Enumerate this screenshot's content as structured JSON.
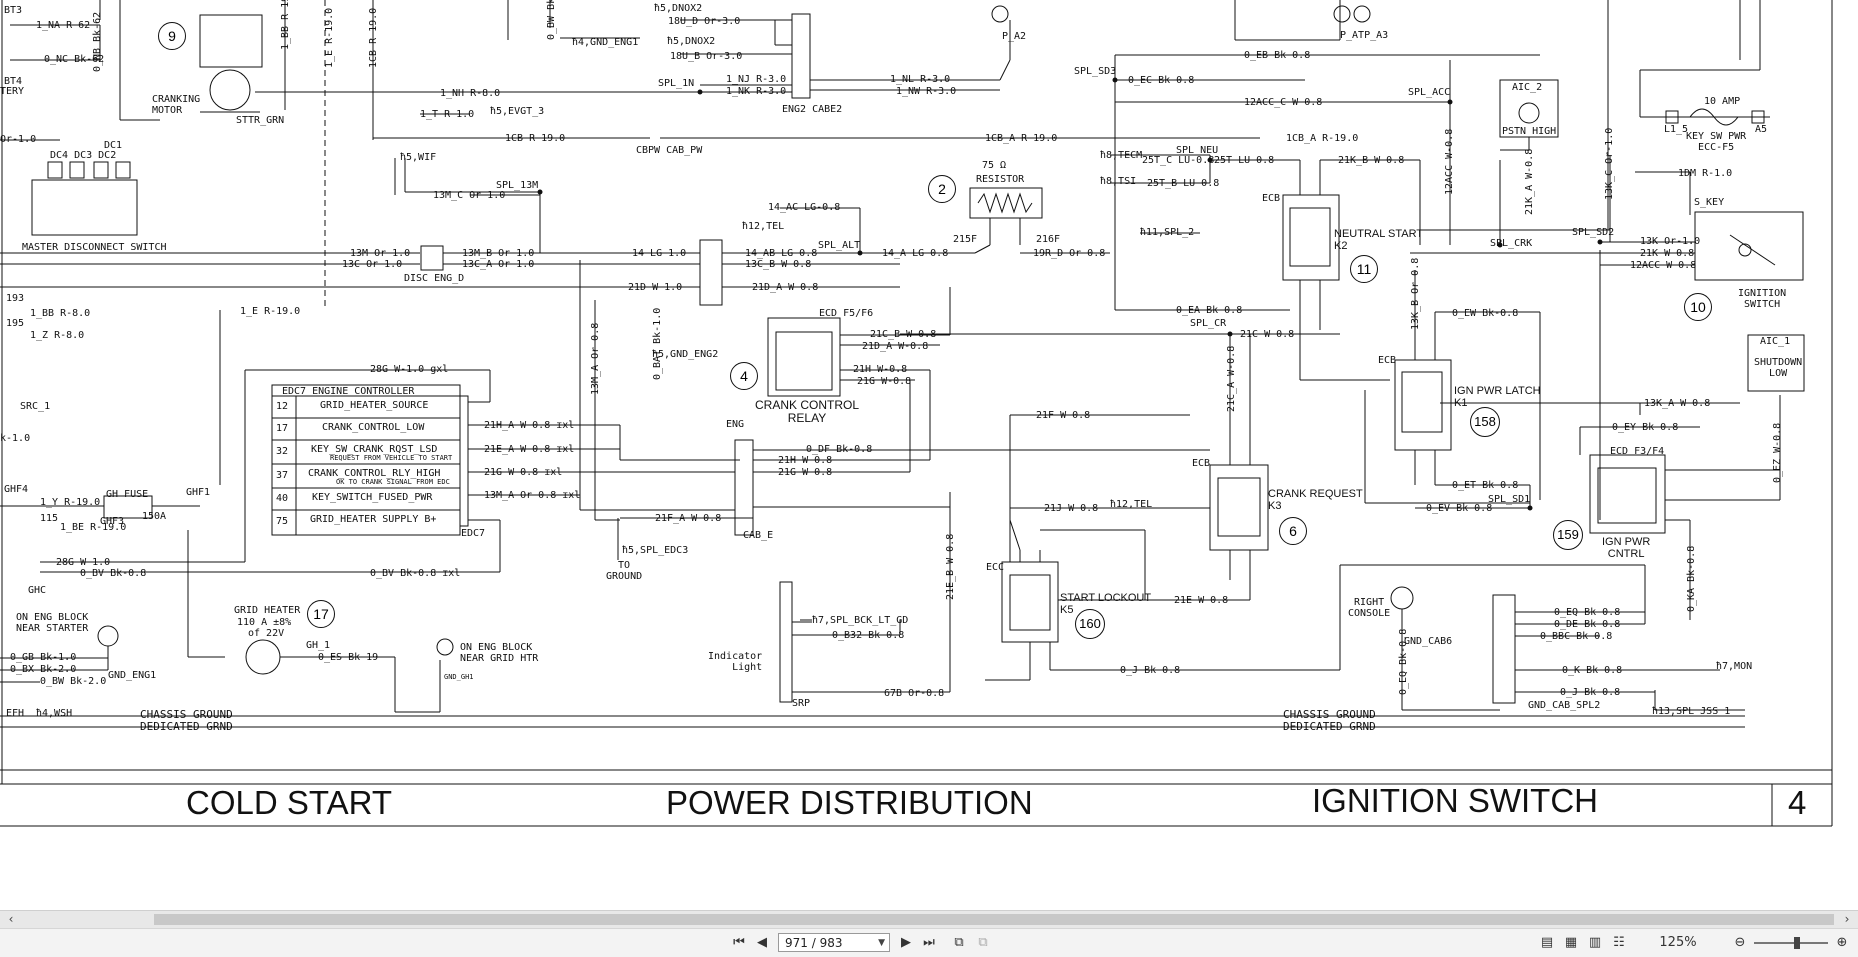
{
  "sections": {
    "cold_start": "COLD START",
    "power_distribution": "POWER DISTRIBUTION",
    "ignition_switch": "IGNITION SWITCH",
    "page_num": "4"
  },
  "ground_labels": {
    "chassis": "CHASSIS GROUND",
    "dedicated": "DEDICATED GRND"
  },
  "components": {
    "bt3": "BT3",
    "bt4": "BT4",
    "battery": "TERY",
    "cranking_motor": "CRANKING\nMOTOR",
    "sttr_grn": "STTR_GRN",
    "master_disconnect": "MASTER DISCONNECT SWITCH",
    "disc_eng": "DISC ENG_D",
    "src1": "SRC_1",
    "gh_fuse": "GH FUSE",
    "gh_fuse_amp": "150A",
    "ghf1": "GHF1",
    "ghf3": "GHF3",
    "ghf4": "GHF4",
    "ghc": "GHC",
    "grid_heater": "GRID HEATER",
    "grid_heater_spec1": "110 A ±8%",
    "grid_heater_spec2": "of 22V",
    "on_eng_block_starter": "ON ENG BLOCK\nNEAR STARTER",
    "gnd_eng1": "GND_ENG1",
    "on_eng_block_grid": "ON ENG BLOCK\nNEAR GRID HTR",
    "gnd_gh1": "GND_GH1",
    "edc7_title": "EDC7 ENGINE CONTROLLER",
    "edc7": "EDC7",
    "edc7_rows": [
      {
        "pin": "12",
        "name": "GRID_HEATER_SOURCE"
      },
      {
        "pin": "17",
        "name": "CRANK_CONTROL_LOW"
      },
      {
        "pin": "32",
        "name": "KEY_SW_CRANK_RQST_LSD",
        "note": "REQUEST FROM VEHICLE TO START"
      },
      {
        "pin": "37",
        "name": "CRANK_CONTROL_RLY_HIGH",
        "note": "OK TO CRANK SIGNAL FROM EDC"
      },
      {
        "pin": "40",
        "name": "KEY_SWITCH_FUSED_PWR"
      },
      {
        "pin": "75",
        "name": "GRID_HEATER SUPPLY B+"
      }
    ],
    "eng2_cabe2": "ENG2 CABE2",
    "cbpw_cab_pw": "CBPW CAB_PW",
    "resistor": "RESISTOR",
    "resistor_val": "75 Ω",
    "crank_control_relay": "CRANK CONTROL\nRELAY",
    "ecd_f5f6": "ECD  F5/F6",
    "to_ground": "TO\nGROUND",
    "indicator_light": "Indicator\nLight",
    "srp": "SRP",
    "neutral_start": "NEUTRAL START\nK2",
    "ign_pwr_latch": "IGN PWR LATCH\nK1",
    "crank_request": "CRANK REQUEST\nK3",
    "start_lockout": "START LOCKOUT\nK5",
    "ign_pwr_cntrl": "IGN PWR\nCNTRL",
    "ecd_f3f4": "ECD  F3/F4",
    "ignition_switch_comp": "IGNITION\nSWITCH",
    "s_key": "S_KEY",
    "key_sw_pwr": "KEY SW PWR\nECC-F5",
    "ten_amp": "10 AMP",
    "aic2": "AIC_2",
    "pstn_high": "PSTN HIGH",
    "aic1": "AIC_1",
    "shutdown_low": "SHUTDOWN\nLOW",
    "right_console": "RIGHT\nCONSOLE",
    "gnd_cab6": "GND_CAB6",
    "gnd_cab_spl2": "GND_CAB_SPL2",
    "ecb": "ECB",
    "ecc": "ECC",
    "eng": "ENG",
    "cab_e": "CAB_E"
  },
  "badges": [
    "9",
    "17",
    "4",
    "2",
    "11",
    "10",
    "158",
    "6",
    "160",
    "159"
  ],
  "wires": {
    "w1": "1_NA R-62",
    "w2": "0_NC Bk-62",
    "w3": "1_BB R-19.0",
    "w4": "1_E R-19.0",
    "w5": "1CB R-19.0",
    "w6": "0_BW Bk-0.8",
    "w7": "1_NH R-8.0",
    "w8": "1_T R-1.0",
    "w9": "ħ5,EVGT_3",
    "w10": "1CB R-19.0",
    "w11": "ħ5,WIF",
    "w12": "13M_C Or-1.0",
    "w13": "SPL_13M",
    "w14": "13M Or-1.0",
    "w15": "13C Or-1.0",
    "w16": "13M_B Or-1.0",
    "w17": "13C_A Or-1.0",
    "w18": "21D W-1.0",
    "w19": "ħ5,DNOX2",
    "w20": "18U_D Or-3.0",
    "w21": "ħ5,DNOX2",
    "w22": "18U_B Or-3.0",
    "w23": "ħ4,GND_ENG1",
    "w24": "SPL_1N",
    "w25": "1_NJ R-3.0",
    "w26": "1_NK R-3.0",
    "w27": "1_NL R-3.0",
    "w28": "1_NW R-3.0",
    "w29": "P_A2",
    "w30": "1CB_A R-19.0",
    "w31": "14_AC LG-0.8",
    "w32": "ħ12,TEL",
    "w33": "14 LG-1.0",
    "w34": "14_AB LG-0.8",
    "w35": "13C_B W-0.8",
    "w36": "SPL_ALT",
    "w37": "14_A LG-0.8",
    "w38": "21D_A W-0.8",
    "w39": "215F",
    "w40": "216F",
    "w41": "19R_D Or-0.8",
    "w42": "1_BB R-8.0",
    "w43": "1_Z R-8.0",
    "w44": "1_E R-19.0",
    "w45": "28G W-1.0 gxl",
    "w46": "ħ5,GND_ENG2",
    "w47": "21C_B W-0.8",
    "w48": "21D_A W-0.8",
    "w49": "21H W-0.8",
    "w50": "21G W-0.8",
    "w51": "0_BAT Bk-1.0",
    "w52": "13M_A Or-0.8",
    "w53": "21H_A W-0.8 ɪxl",
    "w54": "21E_A W-0.8 ɪxl",
    "w55": "21G W-0.8 ɪxl",
    "w56": "13M_A Or-0.8 ɪxl",
    "w57": "0_DF Bk-0.8",
    "w58": "21H W-0.8",
    "w59": "21G W-0.8",
    "w60": "21F_A W-0.8",
    "w61": "ħ5,SPL_EDC3",
    "w62": "1_Y R-19.0",
    "w63": "1_BE R-19.0",
    "w64": "28G W-1.0",
    "w65": "0_BV Bk-0.8",
    "w66": "0_BV Bk-0.8 ɪxl",
    "w67": "0_GB Bk-1.0",
    "w68": "0_BX Bk-2.0",
    "w69": "0_BW Bk-2.0",
    "w70": "GH_1",
    "w71": "0_ES Bk-19",
    "w72": "ħ4,WSH",
    "w73": "ħ7,SPL_BCK_LT_GD",
    "w74": "0_B32 Bk-0.8",
    "w75": "67B Or-0.8",
    "w76": "21E_B W-0.8",
    "w77": "21J W-0.8",
    "w78": "ħ12,TEL",
    "w79": "21F W-0.8",
    "w80": "21E W-0.8",
    "w81": "0_J Bk-0.8",
    "w82": "0_EB Bk-0.8",
    "w83": "SPL_SD3",
    "w84": "0_EC Bk-0.8",
    "w85": "12ACC_C W-0.8",
    "w86": "SPL_ACC",
    "w87": "1CB_A R-19.0",
    "w88": "ħ8,TECM",
    "w89": "ħ8,TSI",
    "w90": "25T_C LU-0.8",
    "w91": "25T_B LU-0.8",
    "w92": "25T LU-0.8",
    "w93": "SPL_NEU",
    "w94": "21K_B W-0.8",
    "w95": "ħ11,SPL_2",
    "w96": "0_EA Bk-0.8",
    "w97": "SPL_CR",
    "w98": "21C W-0.8",
    "w99": "21C_A W-0.8",
    "w100": "12ACC W-0.8",
    "w101": "21K_A W-0.8",
    "w102": "13K_C Or-1.0",
    "w103": "SPL_CRK",
    "w104": "SPL_SD2",
    "w105": "13K Or-1.0",
    "w106": "21K W-0.8",
    "w107": "12ACC W-0.8",
    "w108": "1DM R-1.0",
    "w109": "13K_B Or-0.8",
    "w110": "0_EW Bk-0.8",
    "w111": "13K_A W-0.8",
    "w112": "0_EY Bk-0.8",
    "w113": "0_ET Bk-0.8",
    "w114": "SPL_SD1",
    "w115": "0_EV Bk-0.8",
    "w116": "0_EZ W-0.8",
    "w117": "0_KA Bk-0.8",
    "w118": "0_EQ Bk-0.8",
    "w119": "0_EQ Bk-0.8",
    "w120": "0_DE Bk-0.8",
    "w121": "0_BBC Bk-0.8",
    "w122": "0_K Bk-0.8",
    "w123": "ħ7,MON",
    "w124": "0_J Bk-0.8",
    "w125": "ħ13,SPL_JSS_1",
    "w126": "0_NB Bk-62",
    "w127": "DC1",
    "w128": "DC4 DC3 DC2",
    "w129": "Or-1.0",
    "w130": "193",
    "w131": "195",
    "w132": "115",
    "w133": "k-1.0",
    "w134": "EFH",
    "w135": "L1_5",
    "w136": "A5",
    "w137": "P_ATP_A3"
  },
  "toolbar": {
    "page_current": "971 / 983",
    "zoom": "125%"
  },
  "icons": [
    "first-page-icon",
    "prev-page-icon",
    "next-page-icon",
    "last-page-icon",
    "view-icon"
  ]
}
